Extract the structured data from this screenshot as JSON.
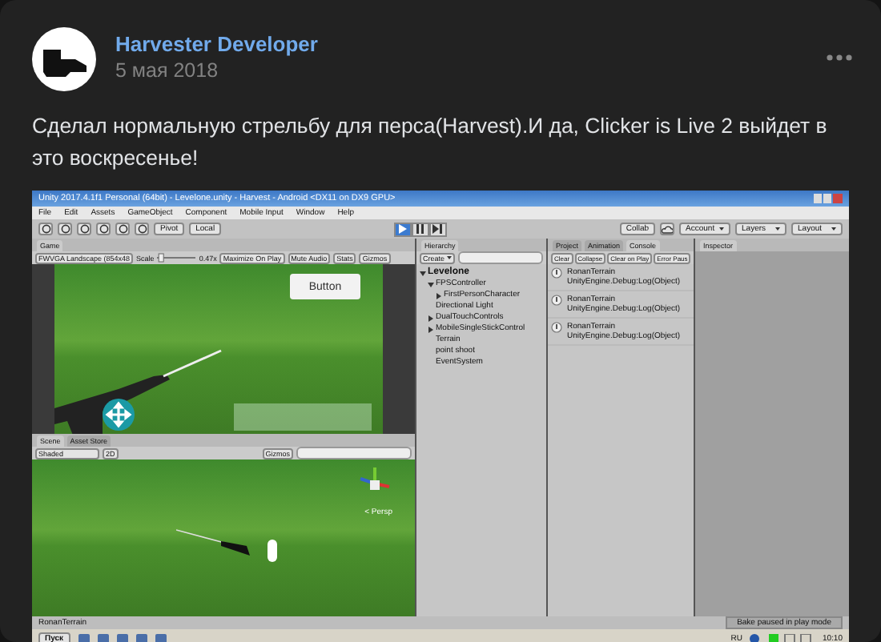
{
  "post": {
    "author": "Harvester Developer",
    "date": "5 мая 2018",
    "text": "Сделал нормальную стрельбу для перса(Harvest).И да, Clicker is Live 2 выйдет в это воскресенье!"
  },
  "unity": {
    "title": "Unity 2017.4.1f1 Personal (64bit) - Levelone.unity - Harvest - Android <DX11 on DX9 GPU>",
    "menu": [
      "File",
      "Edit",
      "Assets",
      "GameObject",
      "Component",
      "Mobile Input",
      "Window",
      "Help"
    ],
    "toolbar": {
      "pivot": "Pivot",
      "local": "Local",
      "collab": "Collab",
      "account": "Account",
      "layers": "Layers",
      "layout": "Layout"
    },
    "play_controls": [
      {
        "kind": "play",
        "selected": true
      },
      {
        "kind": "pause",
        "selected": false
      },
      {
        "kind": "step",
        "selected": false
      }
    ],
    "game_panel": {
      "tab": "Game",
      "resolution": "FWVGA Landscape (854x48",
      "scale_label": "Scale",
      "scale_slider": {
        "level": 0.03
      },
      "scale_value": "0.47x",
      "buttons": [
        "Maximize On Play",
        "Mute Audio",
        "Stats",
        "Gizmos"
      ],
      "ui_button": "Button"
    },
    "scene_panel": {
      "tabs": [
        {
          "label": "Scene",
          "selected": true
        },
        {
          "label": "Asset Store",
          "selected": false
        }
      ],
      "shading": "Shaded",
      "mode": "2D",
      "gizmos": "Gizmos",
      "projection": "< Persp"
    },
    "hierarchy": {
      "tab": "Hierarchy",
      "create": "Create",
      "items": [
        {
          "label": "Levelone",
          "kind": "folder",
          "expanded": true,
          "children": [
            {
              "label": "FPSController",
              "kind": "folder",
              "expanded": true,
              "children": [
                {
                  "label": "FirstPersonCharacter",
                  "kind": "folder",
                  "expanded": false
                }
              ]
            },
            {
              "label": "Directional Light",
              "kind": "leaf"
            },
            {
              "label": "DualTouchControls",
              "kind": "folder",
              "expanded": false
            },
            {
              "label": "MobileSingleStickControl",
              "kind": "folder",
              "expanded": false
            },
            {
              "label": "Terrain",
              "kind": "leaf"
            },
            {
              "label": "point shoot",
              "kind": "leaf"
            },
            {
              "label": "EventSystem",
              "kind": "leaf"
            }
          ]
        }
      ]
    },
    "console_panel": {
      "tabs": [
        {
          "label": "Project",
          "selected": false
        },
        {
          "label": "Animation",
          "selected": false
        },
        {
          "label": "Console",
          "selected": true
        }
      ],
      "buttons": [
        "Clear",
        "Collapse",
        "Clear on Play",
        "Error Paus"
      ],
      "entries": [
        {
          "message": "RonanTerrain",
          "trace": "UnityEngine.Debug:Log(Object)"
        },
        {
          "message": "RonanTerrain",
          "trace": "UnityEngine.Debug:Log(Object)"
        },
        {
          "message": "RonanTerrain",
          "trace": "UnityEngine.Debug:Log(Object)"
        }
      ]
    },
    "inspector": {
      "tab": "Inspector"
    },
    "status_bar": {
      "message": "RonanTerrain",
      "notice": "Bake paused in play mode"
    },
    "taskbar": {
      "start": "Пуск",
      "language": "RU",
      "time": "10:10"
    }
  }
}
